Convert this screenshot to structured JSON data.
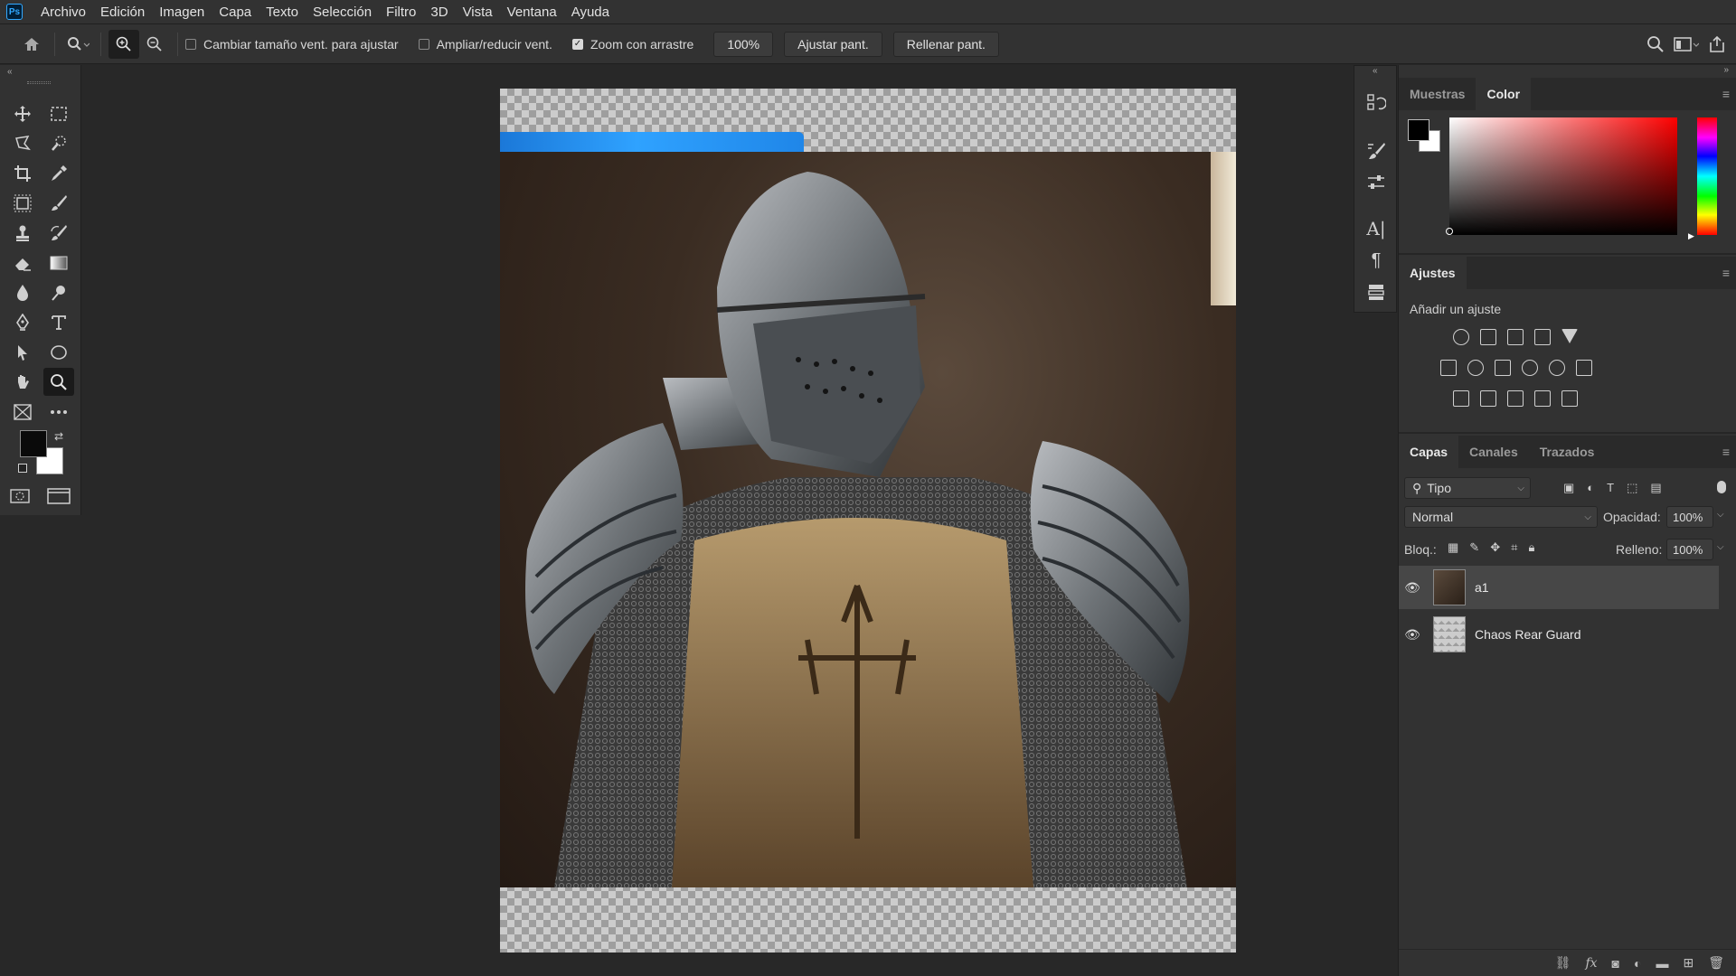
{
  "app": {
    "logo": "Ps"
  },
  "menu": [
    "Archivo",
    "Edición",
    "Imagen",
    "Capa",
    "Texto",
    "Selección",
    "Filtro",
    "3D",
    "Vista",
    "Ventana",
    "Ayuda"
  ],
  "options": {
    "resize_windows_label": "Cambiar tamaño vent. para ajustar",
    "zoom_all_windows_label": "Ampliar/reducir vent.",
    "scrubby_zoom_label": "Zoom con arrastre",
    "zoom_value": "100%",
    "fit_screen_label": "Ajustar pant.",
    "fill_screen_label": "Rellenar pant."
  },
  "color_panel": {
    "tabs": [
      "Muestras",
      "Color"
    ],
    "active_tab": "Color"
  },
  "adjustments_panel": {
    "title": "Ajustes",
    "subtitle": "Añadir un ajuste"
  },
  "layers_panel": {
    "tabs": [
      "Capas",
      "Canales",
      "Trazados"
    ],
    "kind_filter": "Tipo",
    "blend_mode": "Normal",
    "opacity_label": "Opacidad:",
    "opacity_value": "100%",
    "lock_label": "Bloq.:",
    "fill_label": "Relleno:",
    "fill_value": "100%",
    "layers": [
      {
        "name": "a1",
        "selected": true
      },
      {
        "name": "Chaos Rear Guard",
        "selected": false
      }
    ]
  },
  "colors": {
    "accent": "#31a8ff",
    "background": "#282828",
    "panel": "#323232"
  }
}
